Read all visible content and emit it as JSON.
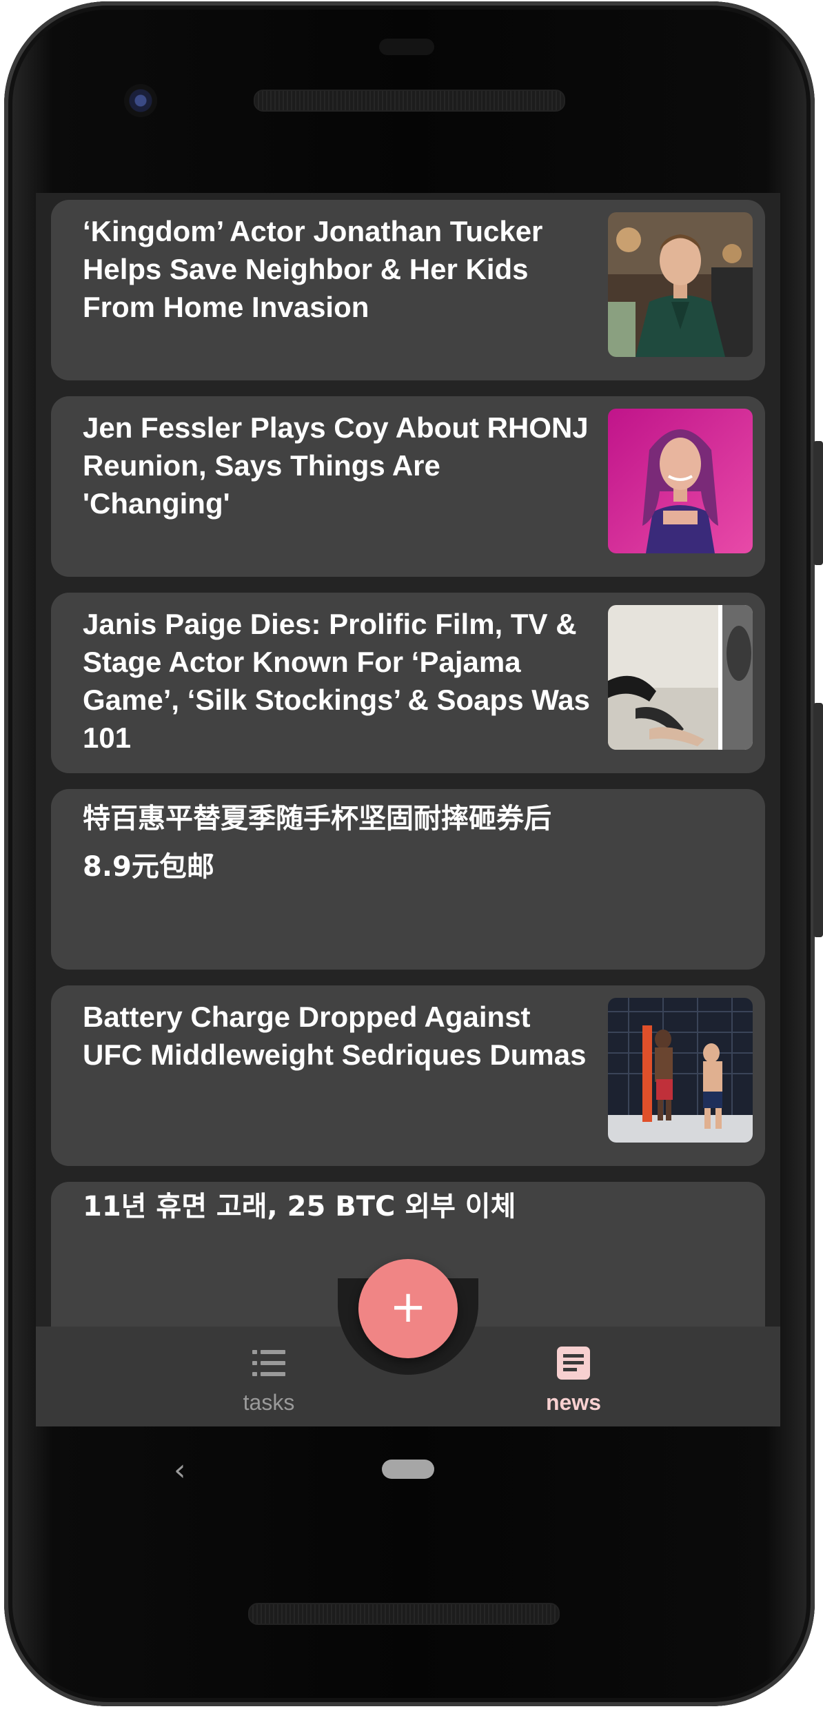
{
  "feed": {
    "articles": [
      {
        "title": "‘Kingdom’ Actor Jonathan Tucker Helps Save Neighbor & Her Kids From Home Invasion",
        "has_image": true
      },
      {
        "title": "Jen Fessler Plays Coy About RHONJ Reunion, Says Things Are 'Changing'",
        "has_image": true
      },
      {
        "title": "Janis Paige Dies: Prolific Film, TV & Stage Actor Known For ‘Pajama Game’, ‘Silk Stockings’ & Soaps Was 101",
        "has_image": true
      },
      {
        "title": "特百惠平替夏季随手杯坚固耐摔砸券后8.9元包邮",
        "has_image": false
      },
      {
        "title": "Battery Charge Dropped Against UFC Middleweight Sedriques Dumas",
        "has_image": true
      },
      {
        "title": "11년 휴면 고래, 25 BTC 외부 이체",
        "has_image": false
      }
    ]
  },
  "fab": {
    "label": "+",
    "icon": "plus-icon",
    "color": "#f08585"
  },
  "bottom_nav": {
    "items": [
      {
        "label": "tasks",
        "icon": "list-icon",
        "active": false
      },
      {
        "label": "news",
        "icon": "article-icon",
        "active": true
      }
    ],
    "active_color": "#f7d0d0"
  },
  "system_nav": {
    "back_glyph": "‹",
    "home_icon": "home-pill-icon"
  },
  "theme": {
    "background": "#242424",
    "card": "#424242",
    "text": "#ffffff"
  }
}
